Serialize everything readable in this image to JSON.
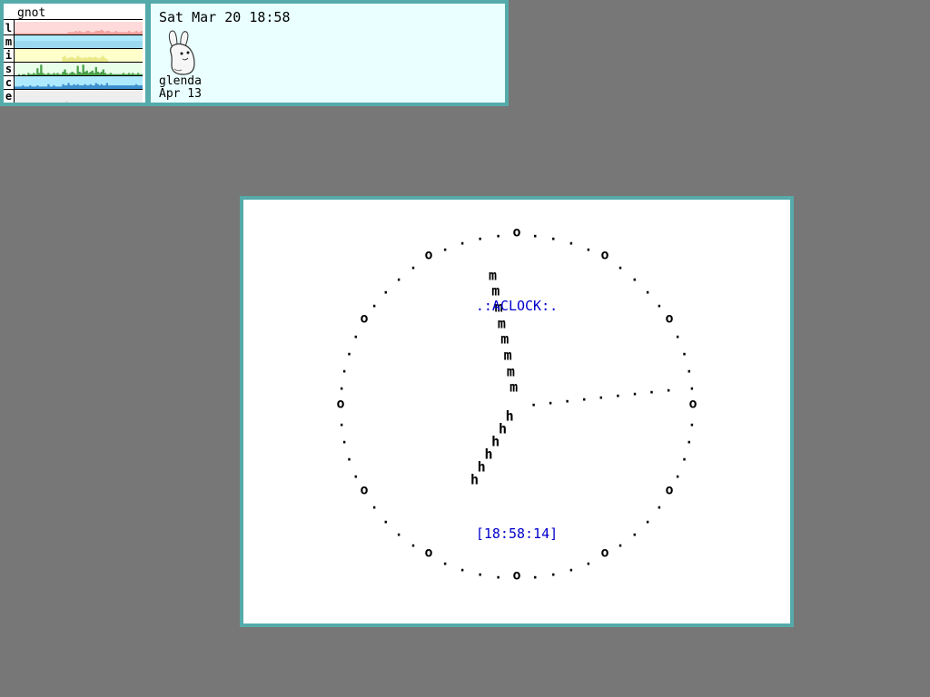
{
  "stats": {
    "title": "gnot",
    "rows": [
      {
        "label": "l",
        "color": "#f4a09c",
        "bg": "#ffdada",
        "line": "#e06060",
        "series": [
          1,
          1,
          1,
          1,
          1,
          1,
          1,
          1,
          1,
          1,
          1,
          1,
          1,
          1,
          1,
          1,
          1,
          1,
          1,
          1,
          1,
          1,
          1,
          1,
          1,
          1,
          1,
          1,
          1,
          2,
          2,
          2,
          2,
          3,
          2,
          3,
          2,
          2,
          2,
          3,
          3,
          2,
          2,
          2,
          3,
          3,
          3,
          4,
          3,
          2,
          3,
          3,
          2,
          2,
          2,
          3,
          2,
          2,
          2,
          2,
          2,
          2,
          3,
          2,
          2,
          2,
          3,
          2,
          2,
          3
        ]
      },
      {
        "label": "m",
        "color": "#9cd8f0",
        "bg": "#aeeaff",
        "line": "#60b8e0",
        "series": [
          6,
          6,
          6,
          6,
          6,
          6,
          6,
          6,
          6,
          6,
          6,
          6,
          6,
          6,
          6,
          6,
          6,
          6,
          6,
          6,
          6,
          6,
          6,
          6,
          6,
          6,
          6,
          6,
          6,
          6,
          6,
          6,
          6,
          6,
          6,
          6,
          6,
          6,
          6,
          6,
          6,
          6,
          6,
          6,
          6,
          6,
          6,
          6,
          6,
          6,
          6,
          6,
          6,
          6,
          6,
          6,
          6,
          6,
          6,
          6,
          6,
          6,
          6,
          6,
          6,
          6,
          6,
          6,
          6,
          6
        ]
      },
      {
        "label": "i",
        "color": "#eaea88",
        "bg": "#ffffcc",
        "line": "#bbbb40",
        "series": [
          0,
          0,
          0,
          0,
          0,
          0,
          0,
          0,
          0,
          0,
          0,
          0,
          0,
          0,
          0,
          0,
          0,
          0,
          0,
          0,
          0,
          0,
          0,
          0,
          0,
          0,
          4,
          5,
          3,
          3,
          4,
          4,
          3,
          3,
          5,
          4,
          3,
          3,
          4,
          3,
          4,
          4,
          3,
          4,
          4,
          3,
          3,
          4,
          5,
          3,
          2,
          0,
          0,
          0,
          0,
          0,
          0,
          0,
          0,
          0,
          0,
          0,
          0,
          0,
          0,
          0,
          0,
          0,
          0,
          0
        ]
      },
      {
        "label": "s",
        "color": "#4aa04a",
        "bg": "#eaffea",
        "line": "#2a802a",
        "series": [
          0,
          0,
          1,
          0,
          1,
          1,
          0,
          2,
          1,
          1,
          2,
          1,
          6,
          2,
          9,
          2,
          1,
          1,
          2,
          1,
          1,
          2,
          1,
          2,
          1,
          1,
          3,
          5,
          2,
          1,
          2,
          3,
          2,
          1,
          8,
          3,
          2,
          9,
          3,
          4,
          2,
          3,
          4,
          2,
          7,
          3,
          2,
          3,
          5,
          2,
          1,
          1,
          2,
          1,
          1,
          1,
          1,
          1,
          1,
          2,
          1,
          1,
          2,
          1,
          2,
          1,
          1,
          2,
          1,
          1
        ]
      },
      {
        "label": "c",
        "color": "#3c90d0",
        "bg": "#aeeaff",
        "line": "#1060b0",
        "series": [
          2,
          2,
          2,
          2,
          3,
          2,
          2,
          2,
          3,
          2,
          2,
          2,
          3,
          2,
          2,
          2,
          2,
          2,
          4,
          2,
          2,
          3,
          2,
          2,
          2,
          2,
          4,
          3,
          3,
          5,
          3,
          3,
          4,
          3,
          4,
          3,
          3,
          3,
          4,
          3,
          3,
          4,
          3,
          3,
          5,
          4,
          3,
          4,
          3,
          3,
          5,
          3,
          3,
          3,
          3,
          3,
          3,
          3,
          3,
          3,
          3,
          3,
          3,
          3,
          3,
          3,
          4,
          3,
          3,
          3
        ]
      },
      {
        "label": "e",
        "color": "#d4d4d4",
        "bg": "#eeeeee",
        "line": "#888888",
        "series": [
          0,
          0,
          0,
          0,
          0,
          0,
          0,
          0,
          0,
          0,
          0,
          0,
          0,
          0,
          0,
          0,
          0,
          0,
          0,
          0,
          0,
          0,
          0,
          0,
          0,
          0,
          0,
          0,
          1,
          0,
          0,
          0,
          0,
          0,
          0,
          0,
          0,
          0,
          0,
          0,
          0,
          0,
          0,
          0,
          0,
          0,
          0,
          0,
          0,
          0,
          0,
          0,
          0,
          0,
          0,
          0,
          0,
          0,
          0,
          0,
          0,
          0,
          0,
          0,
          0,
          0,
          0,
          0,
          0,
          0
        ]
      }
    ]
  },
  "info": {
    "datetime": "Sat Mar 20 18:58",
    "user": "glenda",
    "user_date": "Apr 13",
    "icon": "glenda-bunny-icon"
  },
  "clock": {
    "title": ".:ACLOCK:.",
    "time": "[18:58:14]",
    "hour": 18,
    "minute": 58,
    "second": 14,
    "face_char": ".",
    "hour_mark_char": "o",
    "hour_hand_char": "h",
    "minute_hand_char": "m",
    "second_hand_char": "."
  }
}
